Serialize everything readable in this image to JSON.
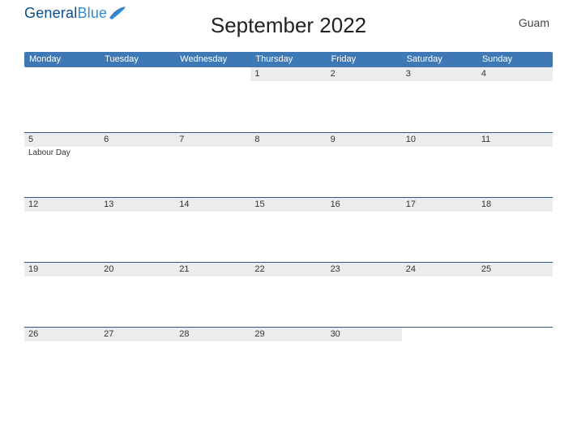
{
  "logo": {
    "part1": "General",
    "part2": "Blue"
  },
  "title": "September 2022",
  "region": "Guam",
  "dayHeaders": [
    "Monday",
    "Tuesday",
    "Wednesday",
    "Thursday",
    "Friday",
    "Saturday",
    "Sunday"
  ],
  "weeks": [
    [
      {
        "date": "",
        "event": ""
      },
      {
        "date": "",
        "event": ""
      },
      {
        "date": "",
        "event": ""
      },
      {
        "date": "1",
        "event": ""
      },
      {
        "date": "2",
        "event": ""
      },
      {
        "date": "3",
        "event": ""
      },
      {
        "date": "4",
        "event": ""
      }
    ],
    [
      {
        "date": "5",
        "event": "Labour Day"
      },
      {
        "date": "6",
        "event": ""
      },
      {
        "date": "7",
        "event": ""
      },
      {
        "date": "8",
        "event": ""
      },
      {
        "date": "9",
        "event": ""
      },
      {
        "date": "10",
        "event": ""
      },
      {
        "date": "11",
        "event": ""
      }
    ],
    [
      {
        "date": "12",
        "event": ""
      },
      {
        "date": "13",
        "event": ""
      },
      {
        "date": "14",
        "event": ""
      },
      {
        "date": "15",
        "event": ""
      },
      {
        "date": "16",
        "event": ""
      },
      {
        "date": "17",
        "event": ""
      },
      {
        "date": "18",
        "event": ""
      }
    ],
    [
      {
        "date": "19",
        "event": ""
      },
      {
        "date": "20",
        "event": ""
      },
      {
        "date": "21",
        "event": ""
      },
      {
        "date": "22",
        "event": ""
      },
      {
        "date": "23",
        "event": ""
      },
      {
        "date": "24",
        "event": ""
      },
      {
        "date": "25",
        "event": ""
      }
    ],
    [
      {
        "date": "26",
        "event": ""
      },
      {
        "date": "27",
        "event": ""
      },
      {
        "date": "28",
        "event": ""
      },
      {
        "date": "29",
        "event": ""
      },
      {
        "date": "30",
        "event": ""
      },
      {
        "date": "",
        "event": ""
      },
      {
        "date": "",
        "event": ""
      }
    ]
  ]
}
